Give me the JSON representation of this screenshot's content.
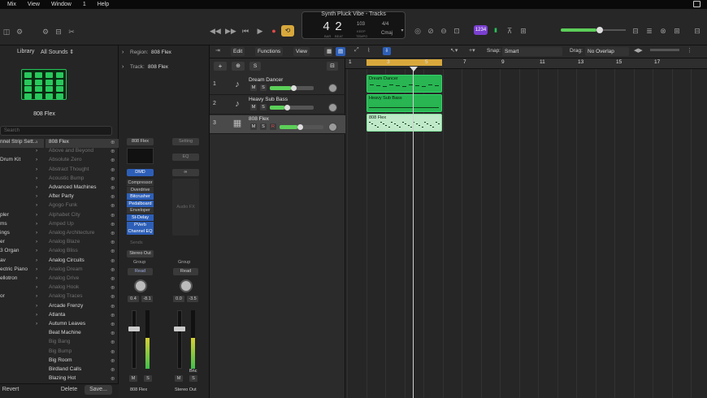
{
  "menubar": {
    "items": [
      "Mix",
      "View",
      "Window",
      "1",
      "Help"
    ]
  },
  "window": {
    "title": "Synth Pluck Vibe - Tracks"
  },
  "lcd": {
    "bar": "4",
    "beat": "2",
    "bar_label": "BAR",
    "beat_label": "BEAT",
    "tempo": "103",
    "tempo_label": "KEEP",
    "tempo_sub": "TEMPO",
    "sig": "4/4",
    "key": "Cmaj"
  },
  "toolbar": {
    "count_in": "1234"
  },
  "library": {
    "title": "Library",
    "filter": "All Sounds ⇕",
    "patch": "808 Flex",
    "search_placeholder": "Search",
    "left": [
      "nnel Strip Sett...",
      "",
      "Drum Kit",
      "",
      "",
      "",
      "",
      "",
      "pler",
      "ms",
      "ings",
      "er",
      "3 Organ",
      "av",
      "ectric Piano",
      "ellotron",
      "",
      "or",
      "",
      "",
      ""
    ],
    "right": [
      "808 Flex",
      "Above and Beyond",
      "Absolute Zero",
      "Abstract Thought",
      "Acoustic Bump",
      "Advanced Machines",
      "After Party",
      "Agogo Funk",
      "Alphabet City",
      "Amped Up",
      "Analog Architecture",
      "Analog Blaze",
      "Analog Bliss",
      "Analog Circuits",
      "Analog Dream",
      "Analog Drive",
      "Analog Hook",
      "Analog Traces",
      "Arcade Frenzy",
      "Atlanta",
      "Autumn Leaves",
      "Beat Machine",
      "Big Bang",
      "Big Bump",
      "Big Room",
      "Birdland Calls",
      "Blazing Hot"
    ],
    "revert": "Revert",
    "delete": "Delete",
    "save": "Save..."
  },
  "inspector": {
    "region_label": "Region:",
    "region": "808 Flex",
    "track_label": "Track:",
    "track": "808 Flex",
    "strip1": {
      "name": "808 Flex",
      "dmd": "DMD",
      "plugins": [
        "Compressor",
        "Overdrive",
        "Bitcrusher",
        "Pedalboard",
        "Enveloper",
        "St-Delay",
        "PVerb",
        "Channel EQ"
      ],
      "sends": "Sends",
      "output": "Stereo Out",
      "group": "Group",
      "auto": "Read",
      "vol": "0.4",
      "pk": "-8.1",
      "m": "M",
      "s": "S",
      "label": "808 Flex"
    },
    "strip2": {
      "setting": "Setting",
      "eq": "EQ",
      "link": "∞",
      "audiofx": "Audio FX",
      "auto": "Read",
      "group": "Group",
      "vol": "0.0",
      "pk": "-3.5",
      "m": "M",
      "s": "S",
      "bnc": "Bnc",
      "label": "Stereo Out"
    }
  },
  "tracks": {
    "edit": "Edit",
    "functions": "Functions",
    "view": "View",
    "snap_label": "Snap:",
    "snap": "Smart",
    "drag_label": "Drag:",
    "drag": "No Overlap",
    "add": "+",
    "s": "S",
    "list": [
      {
        "num": "1",
        "name": "Dream Dancer"
      },
      {
        "num": "2",
        "name": "Heavy Sub Bass"
      },
      {
        "num": "3",
        "name": "808 Flex"
      }
    ]
  },
  "ruler": [
    "1",
    "3",
    "5",
    "7",
    "9",
    "11",
    "13",
    "15",
    "17"
  ],
  "regions": [
    {
      "name": "Dream Dancer"
    },
    {
      "name": "Heavy Sub Bass"
    },
    {
      "name": "808 Flex"
    }
  ],
  "colors": {
    "accent": "#28b552",
    "cycle": "#d8a83c",
    "countin": "#7a3fd0",
    "blue": "#2d5fb8"
  }
}
